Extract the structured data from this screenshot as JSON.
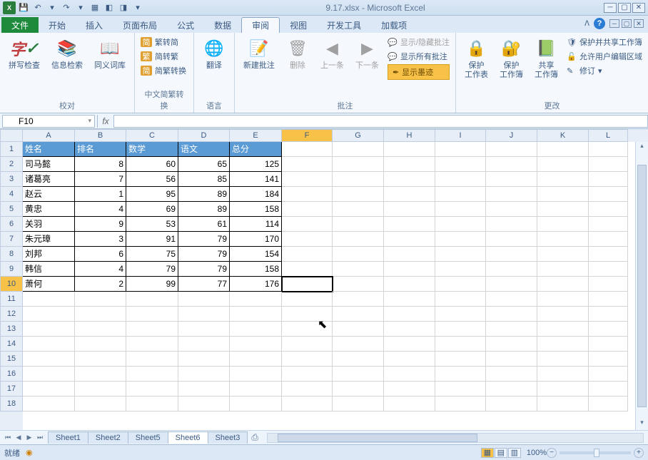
{
  "title": "9.17.xlsx - Microsoft Excel",
  "qat": {
    "save": "💾",
    "undo": "↶",
    "redo": "↷"
  },
  "tabs": {
    "file": "文件",
    "home": "开始",
    "insert": "插入",
    "pagelayout": "页面布局",
    "formulas": "公式",
    "data": "数据",
    "review": "审阅",
    "view": "视图",
    "developer": "开发工具",
    "addins": "加载项"
  },
  "ribbon": {
    "proofing": {
      "label": "校对",
      "spelling": "拼写检查",
      "research": "信息检索",
      "thesaurus": "同义词库"
    },
    "chinese": {
      "label": "中文简繁转换",
      "ts": "繁转简",
      "st": "简转繁",
      "conv": "简繁转换"
    },
    "language": {
      "label": "语言",
      "translate": "翻译"
    },
    "comments": {
      "label": "批注",
      "new": "新建批注",
      "delete": "删除",
      "prev": "上一条",
      "next": "下一条",
      "showhide": "显示/隐藏批注",
      "showall": "显示所有批注",
      "showink": "显示墨迹"
    },
    "changes": {
      "label": "更改",
      "protectsheet": "保护\n工作表",
      "protectwb": "保护\n工作簿",
      "sharewb": "共享\n工作簿",
      "protectshare": "保护并共享工作簿",
      "alloweditranges": "允许用户编辑区域",
      "track": "修订"
    }
  },
  "namebox": "F10",
  "fx": "fx",
  "columns": [
    "A",
    "B",
    "C",
    "D",
    "E",
    "F",
    "G",
    "H",
    "I",
    "J",
    "K",
    "L"
  ],
  "rowcount": 18,
  "active_col": "F",
  "active_row": 10,
  "headers": {
    "A": "姓名",
    "B": "排名",
    "C": "数学",
    "D": "语文",
    "E": "总分"
  },
  "data": [
    {
      "A": "司马懿",
      "B": 8,
      "C": 60,
      "D": 65,
      "E": 125
    },
    {
      "A": "诸葛亮",
      "B": 7,
      "C": 56,
      "D": 85,
      "E": 141
    },
    {
      "A": "赵云",
      "B": 1,
      "C": 95,
      "D": 89,
      "E": 184
    },
    {
      "A": "黄忠",
      "B": 4,
      "C": 69,
      "D": 89,
      "E": 158
    },
    {
      "A": "关羽",
      "B": 9,
      "C": 53,
      "D": 61,
      "E": 114
    },
    {
      "A": "朱元璋",
      "B": 3,
      "C": 91,
      "D": 79,
      "E": 170
    },
    {
      "A": "刘邦",
      "B": 6,
      "C": 75,
      "D": 79,
      "E": 154
    },
    {
      "A": "韩信",
      "B": 4,
      "C": 79,
      "D": 79,
      "E": 158
    },
    {
      "A": "萧何",
      "B": 2,
      "C": 99,
      "D": 77,
      "E": 176
    }
  ],
  "sheets": [
    "Sheet1",
    "Sheet2",
    "Sheet5",
    "Sheet6",
    "Sheet3"
  ],
  "active_sheet": "Sheet6",
  "status": "就绪",
  "zoom": "100%"
}
